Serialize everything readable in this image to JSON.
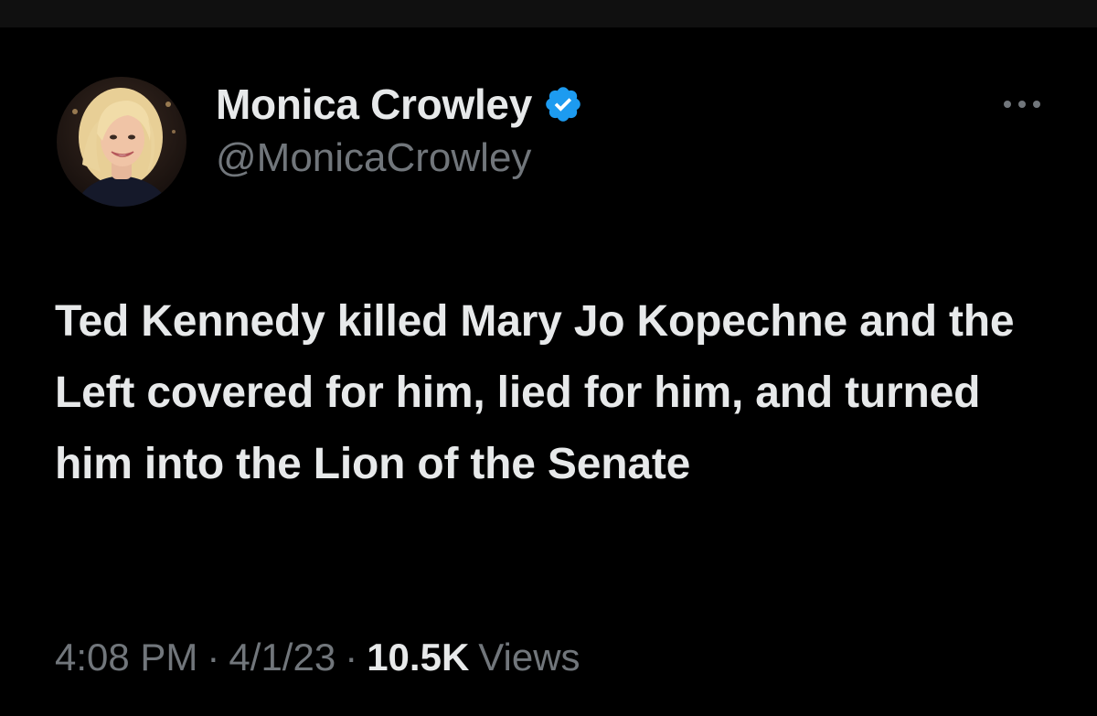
{
  "author": {
    "display_name": "Monica Crowley",
    "handle": "@MonicaCrowley",
    "verified": true
  },
  "tweet": {
    "text": "Ted Kennedy killed Mary Jo Kopechne and the Left covered for him, lied for him, and turned him into the Lion of the Senate"
  },
  "meta": {
    "time": "4:08 PM",
    "separator": "·",
    "date": "4/1/23",
    "views_count": "10.5K",
    "views_label": "Views"
  },
  "icons": {
    "verified": "verified-badge-icon",
    "more": "more-options-icon"
  },
  "colors": {
    "background": "#000000",
    "text_primary": "#e7e9ea",
    "text_secondary": "#71767b",
    "verified_blue": "#1d9bf0"
  }
}
